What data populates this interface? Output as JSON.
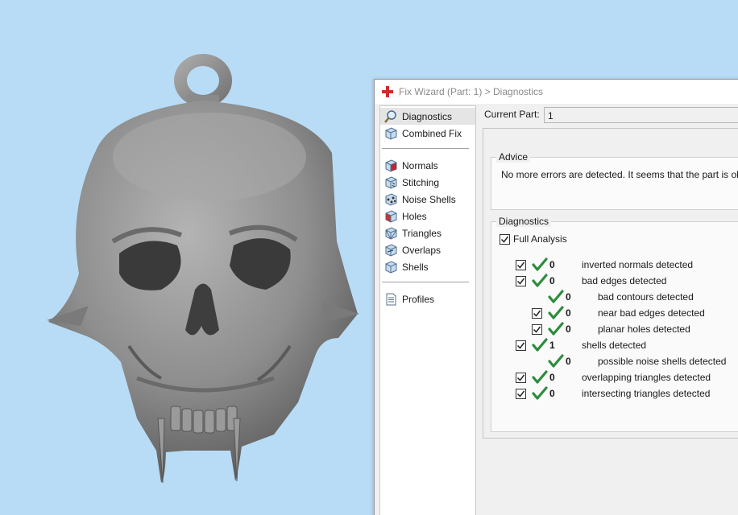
{
  "dialog": {
    "title": "Fix Wizard (Part: 1) > Diagnostics"
  },
  "sidebar": {
    "items": [
      {
        "label": "Diagnostics",
        "icon": "magnifier-icon",
        "selected": true
      },
      {
        "label": "Combined Fix",
        "icon": "cube-icon"
      },
      {
        "label": "Normals",
        "icon": "normals-cube-icon"
      },
      {
        "label": "Stitching",
        "icon": "stitching-cube-icon"
      },
      {
        "label": "Noise Shells",
        "icon": "noise-shells-icon"
      },
      {
        "label": "Holes",
        "icon": "holes-cube-icon"
      },
      {
        "label": "Triangles",
        "icon": "triangles-cube-icon"
      },
      {
        "label": "Overlaps",
        "icon": "overlaps-cube-icon"
      },
      {
        "label": "Shells",
        "icon": "shells-cube-icon"
      },
      {
        "label": "Profiles",
        "icon": "document-icon"
      }
    ]
  },
  "main": {
    "current_part_label": "Current Part:",
    "current_part_value": "1",
    "advice": {
      "title": "Advice",
      "text": "No more errors are detected. It seems that the part is ok."
    },
    "diagnostics": {
      "title": "Diagnostics",
      "full_analysis_label": "Full Analysis",
      "full_analysis_checked": true,
      "rows": [
        {
          "checkbox": true,
          "checked": true,
          "count": "0",
          "label": "inverted normals detected",
          "indent": 0
        },
        {
          "checkbox": true,
          "checked": true,
          "count": "0",
          "label": "bad edges detected",
          "indent": 0
        },
        {
          "checkbox": false,
          "checked": false,
          "count": "0",
          "label": "bad contours detected",
          "indent": 1
        },
        {
          "checkbox": true,
          "checked": true,
          "count": "0",
          "label": "near bad edges detected",
          "indent": 1
        },
        {
          "checkbox": true,
          "checked": true,
          "count": "0",
          "label": "planar holes detected",
          "indent": 1
        },
        {
          "checkbox": true,
          "checked": true,
          "count": "1",
          "label": "shells detected",
          "indent": 0
        },
        {
          "checkbox": false,
          "checked": false,
          "count": "0",
          "label": "possible noise shells detected",
          "indent": 1
        },
        {
          "checkbox": true,
          "checked": true,
          "count": "0",
          "label": "overlapping triangles detected",
          "indent": 0
        },
        {
          "checkbox": true,
          "checked": true,
          "count": "0",
          "label": "intersecting triangles detected",
          "indent": 0
        }
      ]
    }
  },
  "colors": {
    "viewport_bg": "#b8dcf6",
    "model": "#8f8f8f",
    "check_green": "#2e8b3e"
  }
}
